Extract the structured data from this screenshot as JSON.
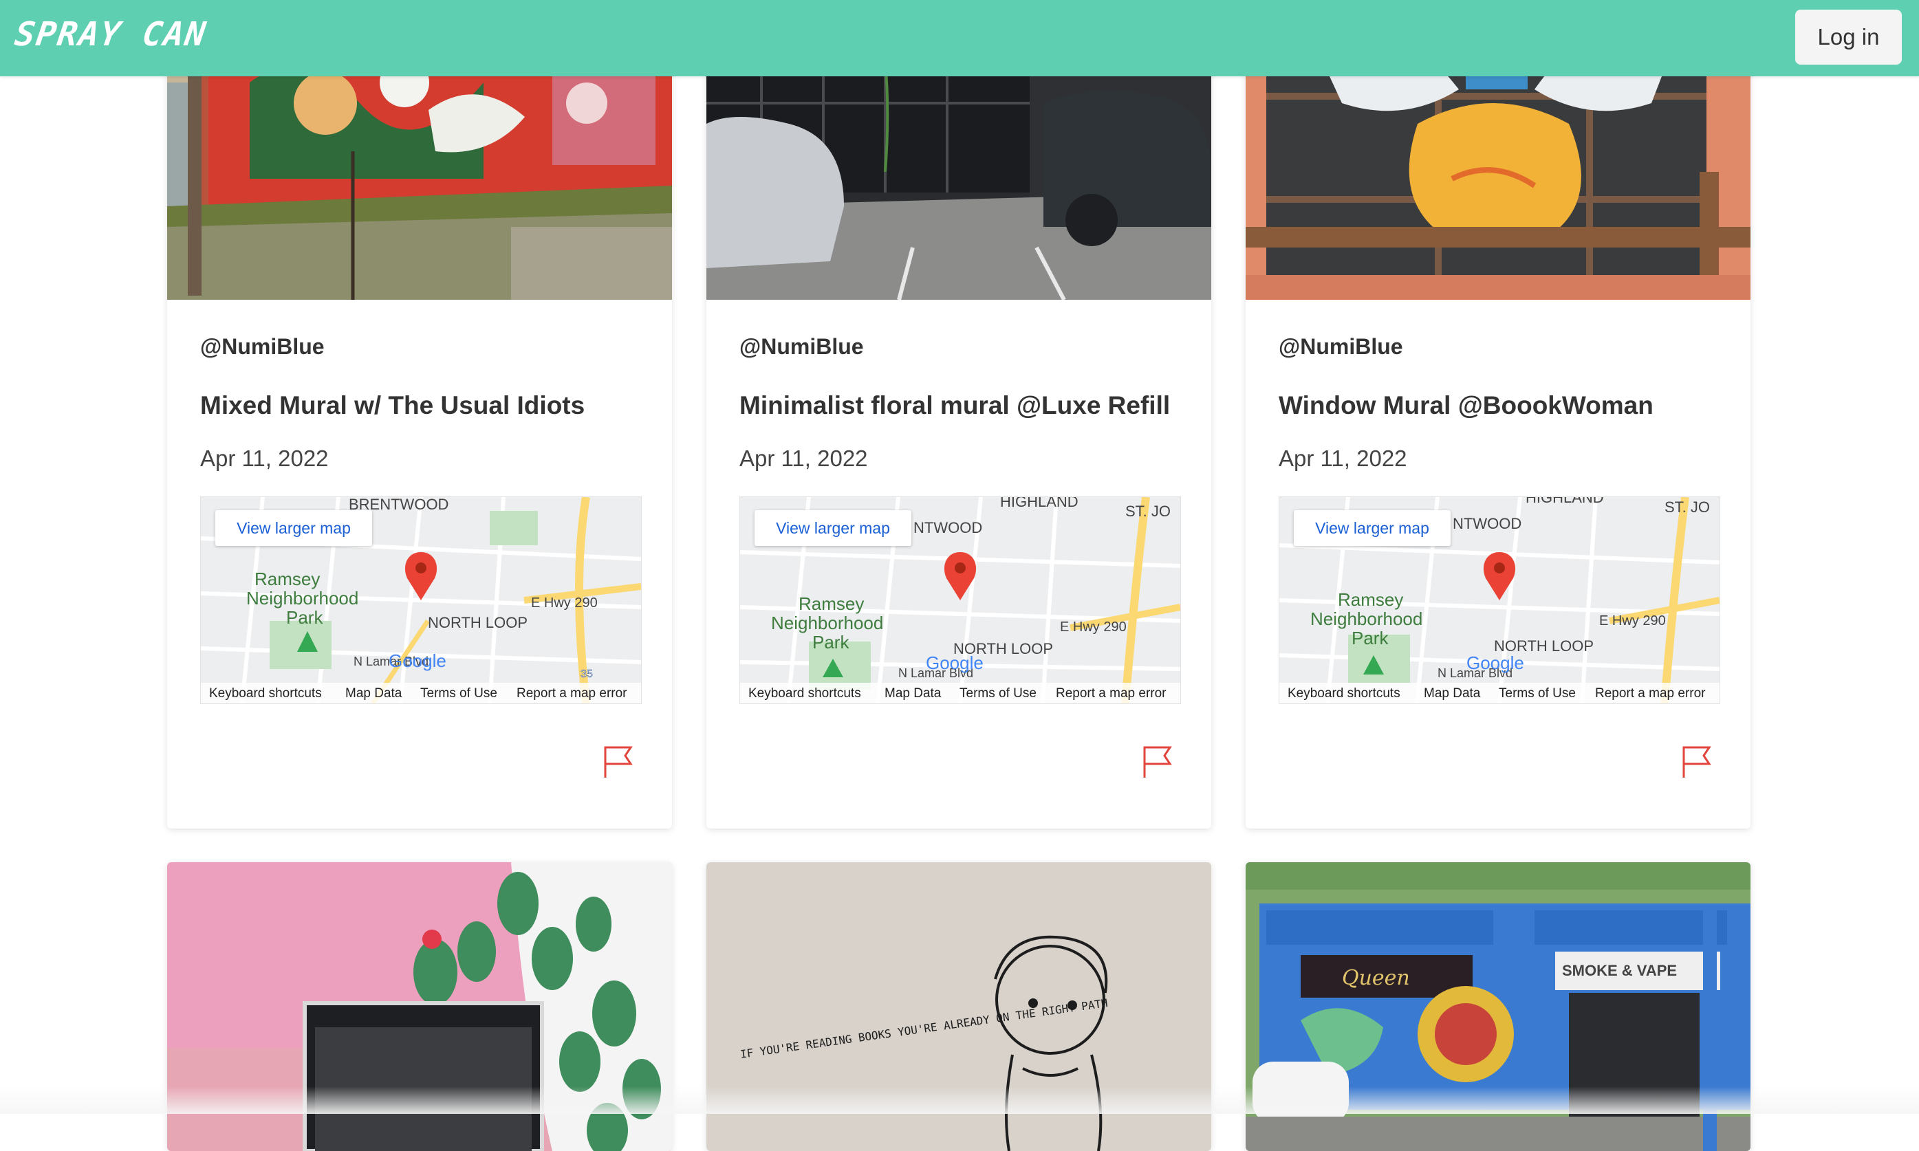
{
  "brand": {
    "name": "SPRAY CAN"
  },
  "header": {
    "login_label": "Log in"
  },
  "map_labels": {
    "view_larger": "View larger map",
    "keyboard": "Keyboard shortcuts",
    "map_data": "Map Data",
    "terms": "Terms of Use",
    "report": "Report a map error",
    "google": "Google",
    "park": [
      "Ramsey",
      "Neighborhood",
      "Park"
    ],
    "north_loop": "NORTH LOOP",
    "hwy": "E Hwy 290",
    "lamar": "N Lamar Blvd",
    "brentwood": "BRENTWOOD",
    "ntwood": "NTWOOD",
    "highland": "HIGHLAND",
    "st_jo": "ST. JO",
    "shield": "35"
  },
  "posts": [
    {
      "author": "@NumiBlue",
      "title": "Mixed Mural w/ The Usual Idiots",
      "date": "Apr 11, 2022"
    },
    {
      "author": "@NumiBlue",
      "title": "Minimalist floral mural @Luxe Refill",
      "date": "Apr 11, 2022"
    },
    {
      "author": "@NumiBlue",
      "title": "Window Mural @BoookWoman",
      "date": "Apr 11, 2022"
    }
  ],
  "photo_text": {
    "reading_books": "IF YOU'RE READING BOOKS YOU'RE ALREADY ON THE RIGHT PATH",
    "salon": "Queen",
    "smoke": "SMOKE & VAPE"
  },
  "colors": {
    "navbar": "#5ecfb1",
    "flag": "#e2453c",
    "map_pin": "#ea4335",
    "link": "#1a5fd6"
  }
}
